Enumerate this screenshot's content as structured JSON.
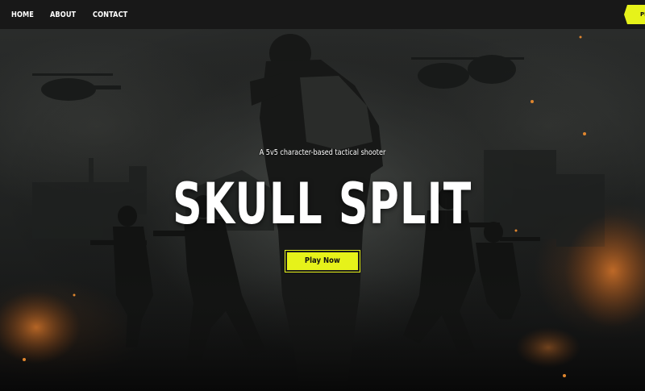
{
  "nav": {
    "links": [
      "HOME",
      "ABOUT",
      "CONTACT"
    ],
    "cta_label": "PLAY NOW"
  },
  "hero": {
    "tagline": "A 5v5 character-based tactical shooter",
    "title": "SKULL SPLIT",
    "play_button": "Play Now"
  },
  "colors": {
    "accent": "#e6f21a",
    "nav_bg": "#181818",
    "text": "#ffffff"
  }
}
